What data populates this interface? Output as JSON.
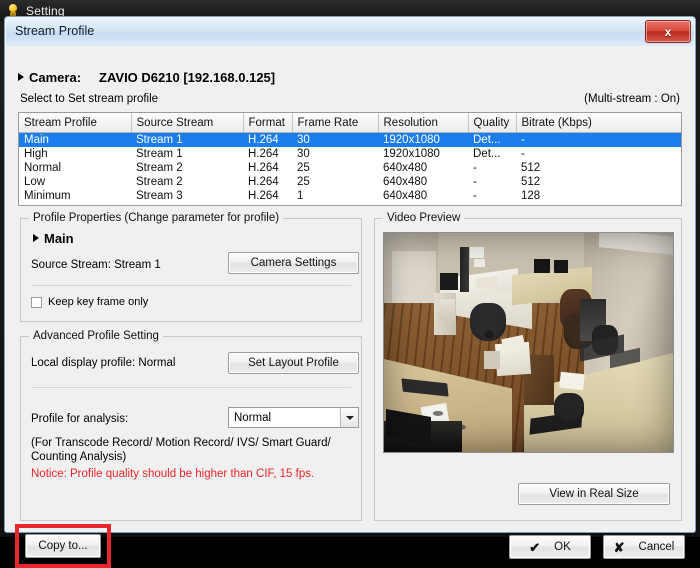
{
  "os_window": {
    "title": "Setting",
    "icon": "lightbulb-icon"
  },
  "dialog": {
    "title": "Stream Profile",
    "close_label": "x"
  },
  "camera": {
    "label": "Camera:",
    "value": "ZAVIO D6210 [192.168.0.125]",
    "select_hint": "Select to Set stream profile",
    "multistream": "(Multi-stream : On)"
  },
  "table": {
    "columns": [
      "Stream Profile",
      "Source Stream",
      "Format",
      "Frame Rate",
      "Resolution",
      "Quality",
      "Bitrate (Kbps)"
    ],
    "rows": [
      {
        "profile": "Main",
        "source": "Stream  1",
        "format": "H.264",
        "fps": "30",
        "resolution": "1920x1080",
        "quality": "Det...",
        "bitrate": "-",
        "selected": true
      },
      {
        "profile": "High",
        "source": "Stream  1",
        "format": "H.264",
        "fps": "30",
        "resolution": "1920x1080",
        "quality": "Det...",
        "bitrate": "-",
        "selected": false
      },
      {
        "profile": "Normal",
        "source": "Stream  2",
        "format": "H.264",
        "fps": "25",
        "resolution": "640x480",
        "quality": "-",
        "bitrate": "512",
        "selected": false
      },
      {
        "profile": "Low",
        "source": "Stream  2",
        "format": "H.264",
        "fps": "25",
        "resolution": "640x480",
        "quality": "-",
        "bitrate": "512",
        "selected": false
      },
      {
        "profile": "Minimum",
        "source": "Stream  3",
        "format": "H.264",
        "fps": "1",
        "resolution": "640x480",
        "quality": "-",
        "bitrate": "128",
        "selected": false
      }
    ]
  },
  "profile_properties": {
    "legend": "Profile Properties (Change parameter for profile)",
    "profile_name": "Main",
    "source_stream_line": "Source Stream: Stream  1",
    "camera_settings_button": "Camera Settings",
    "keep_key_frame_label": "Keep key frame only",
    "keep_key_frame_checked": false
  },
  "advanced": {
    "legend": "Advanced Profile Setting",
    "local_display_line": "Local display profile:  Normal",
    "set_layout_button": "Set Layout Profile",
    "profile_for_analysis_label": "Profile for analysis:",
    "profile_for_analysis_value": "Normal",
    "note_line_1": "(For Transcode Record/ Motion Record/ IVS/ Smart Guard/",
    "note_line_2": "Counting Analysis)",
    "notice": "Notice: Profile quality should be higher than CIF, 15 fps.",
    "notice_color": "#e8262d"
  },
  "video_preview": {
    "legend": "Video Preview",
    "view_real_size_button": "View in Real Size",
    "scene_description": "Overhead office camera view with desks, chairs and wood floor"
  },
  "footer": {
    "copy_to_button": "Copy to...",
    "ok_button": "OK",
    "cancel_button": "Cancel",
    "ok_glyph": "✔",
    "cancel_glyph": "✘",
    "highlight_color": "#e8262d",
    "highlighted_control": "copy-to-button"
  }
}
